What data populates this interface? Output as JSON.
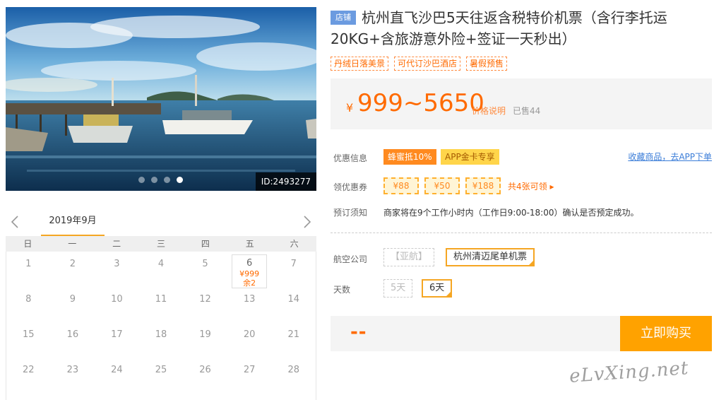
{
  "gallery": {
    "photo_id": "ID:2493277",
    "dot_count": 4,
    "active_dot": 3
  },
  "calendar": {
    "month": "2019年9月",
    "weekdays": [
      "日",
      "一",
      "二",
      "三",
      "四",
      "五",
      "六"
    ],
    "days": [
      {
        "d": "1"
      },
      {
        "d": "2"
      },
      {
        "d": "3"
      },
      {
        "d": "4"
      },
      {
        "d": "5"
      },
      {
        "d": "6",
        "price": "¥999",
        "left": "余2"
      },
      {
        "d": "7"
      },
      {
        "d": "8"
      },
      {
        "d": "9"
      },
      {
        "d": "10"
      },
      {
        "d": "11"
      },
      {
        "d": "12"
      },
      {
        "d": "13"
      },
      {
        "d": "14"
      },
      {
        "d": "15"
      },
      {
        "d": "16"
      },
      {
        "d": "17"
      },
      {
        "d": "18"
      },
      {
        "d": "19"
      },
      {
        "d": "20"
      },
      {
        "d": "21"
      },
      {
        "d": "22"
      },
      {
        "d": "23"
      },
      {
        "d": "24"
      },
      {
        "d": "25"
      },
      {
        "d": "26"
      },
      {
        "d": "27"
      },
      {
        "d": "28"
      }
    ]
  },
  "product": {
    "store_badge": "店铺",
    "title": "杭州直飞沙巴5天往返含税特价机票（含行李托运20KG+含旅游意外险+签证一天秒出）",
    "tags": [
      "丹绒日落美景",
      "可代订沙巴酒店",
      "暑假预售"
    ]
  },
  "price": {
    "currency": "¥",
    "range": "999~5650",
    "note": "价格说明",
    "sold": "已售44"
  },
  "discount": {
    "label": "优惠信息",
    "promo1": "蜂蜜抵10%",
    "promo2": "APP金卡专享",
    "app_link": "收藏商品，去APP下单"
  },
  "coupons": {
    "label": "领优惠券",
    "items": [
      "¥88",
      "¥50",
      "¥188"
    ],
    "more": "共4张可领 ▸"
  },
  "booking": {
    "label": "预订须知",
    "notice": "商家将在9个工作小时内（工作日9:00-18:00）确认是否预定成功。"
  },
  "airline": {
    "label": "航空公司",
    "options": [
      "【亚航】",
      "杭州清迈尾单机票"
    ]
  },
  "days_opt": {
    "label": "天数",
    "options": [
      "5天",
      "6天"
    ]
  },
  "buy": {
    "price_placeholder": "--",
    "button": "立即购买"
  },
  "watermark": "eLvXing.net",
  "colors": {
    "accent": "#ff6a00",
    "button": "#ffa200",
    "selected_border": "#f5a623",
    "store_badge": "#6b9be0"
  }
}
